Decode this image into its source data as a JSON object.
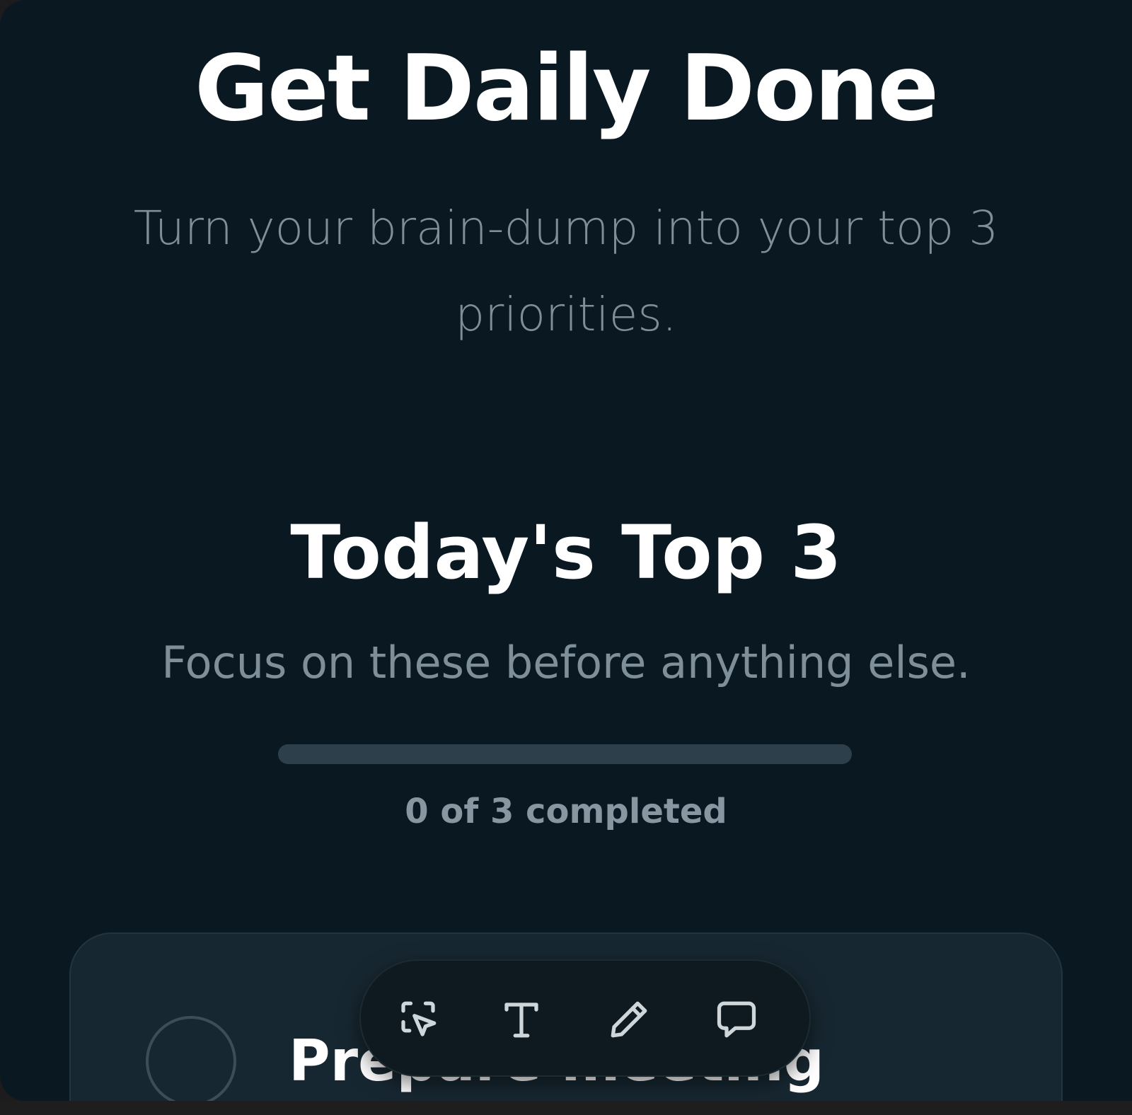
{
  "hero": {
    "title": "Get Daily Done",
    "subtitle": "Turn your brain-dump into your top 3 priorities."
  },
  "section": {
    "title": "Today's Top 3",
    "subtitle": "Focus on these before anything else."
  },
  "progress": {
    "completed": 0,
    "total": 3,
    "fraction": 0,
    "label": "0 of 3 completed"
  },
  "tasks": [
    {
      "title": "Prepare meeting",
      "done": false
    }
  ],
  "toolbar": {
    "tools": [
      {
        "name": "select-tool",
        "icon": "cursor-select-icon"
      },
      {
        "name": "text-tool",
        "icon": "text-icon"
      },
      {
        "name": "draw-tool",
        "icon": "pencil-icon"
      },
      {
        "name": "comment-tool",
        "icon": "speech-bubble-icon"
      }
    ]
  },
  "colors": {
    "background": "#0a1921",
    "card": "#172731",
    "muted_text": "#7f8f99",
    "progress_track": "#2d3f4a"
  }
}
